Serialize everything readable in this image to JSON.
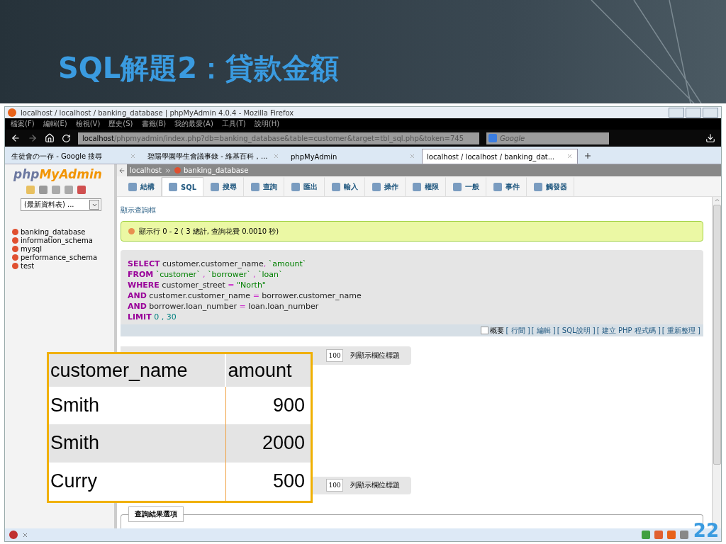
{
  "slide": {
    "title": "SQL解題2：貸款金額",
    "page_number": "22"
  },
  "browser": {
    "window_title": "localhost / localhost / banking_database | phpMyAdmin 4.0.4 - Mozilla Firefox",
    "menu": [
      "檔案(F)",
      "編輯(E)",
      "檢視(V)",
      "歷史(S)",
      "書籤(B)",
      "我的最愛(A)",
      "工具(T)",
      "說明(H)"
    ],
    "address": {
      "host": "localhost",
      "path": "/phpmyadmin/index.php?db=banking_database&table=customer&target=tbl_sql.php&token=745"
    },
    "search_placeholder": "Google",
    "tabs": [
      {
        "label": "生徒會の一存 - Google 搜尋",
        "selected": false
      },
      {
        "label": "碧陽學園學生會議事錄 - 維基百科，...",
        "selected": false
      },
      {
        "label": "phpMyAdmin",
        "selected": false
      },
      {
        "label": "localhost / localhost / banking_dat...",
        "selected": true
      }
    ]
  },
  "sidebar": {
    "logo": {
      "part_1": "php",
      "part_2": "MyAdmin"
    },
    "recent_select": "(最新資料表) ...",
    "databases": [
      "banking_database",
      "information_schema",
      "mysql",
      "performance_schema",
      "test"
    ]
  },
  "breadcrumb": [
    "localhost",
    "banking_database"
  ],
  "pma_tabs": [
    {
      "label": "結構",
      "selected": false
    },
    {
      "label": "SQL",
      "selected": true
    },
    {
      "label": "搜尋",
      "selected": false
    },
    {
      "label": "查詢",
      "selected": false
    },
    {
      "label": "匯出",
      "selected": false
    },
    {
      "label": "輸入",
      "selected": false
    },
    {
      "label": "操作",
      "selected": false
    },
    {
      "label": "權限",
      "selected": false
    },
    {
      "label": "一般",
      "selected": false
    },
    {
      "label": "事件",
      "selected": false
    },
    {
      "label": "觸發器",
      "selected": false
    }
  ],
  "show_query_link": "顯示查詢框",
  "success_message": "顯示行 0 - 2 ( 3 總計, 查詢花費 0.0010 秒)",
  "sql_lines": [
    [
      {
        "kind": "keyword",
        "text": "SELECT"
      },
      {
        "kind": "plain",
        "text": " customer.customer_name"
      },
      {
        "kind": "punct",
        "text": ", "
      },
      {
        "kind": "string",
        "text": "`amount`"
      }
    ],
    [
      {
        "kind": "keyword",
        "text": "FROM"
      },
      {
        "kind": "string",
        "text": " `customer`"
      },
      {
        "kind": "punct",
        "text": " , "
      },
      {
        "kind": "string",
        "text": "`borrower`"
      },
      {
        "kind": "punct",
        "text": " , "
      },
      {
        "kind": "string",
        "text": "`loan`"
      }
    ],
    [
      {
        "kind": "keyword",
        "text": "WHERE"
      },
      {
        "kind": "plain",
        "text": " customer_street "
      },
      {
        "kind": "punct",
        "text": "="
      },
      {
        "kind": "string",
        "text": " \"North\""
      }
    ],
    [
      {
        "kind": "keyword",
        "text": "AND"
      },
      {
        "kind": "plain",
        "text": " customer.customer_name "
      },
      {
        "kind": "punct",
        "text": "="
      },
      {
        "kind": "plain",
        "text": " borrower.customer_name"
      }
    ],
    [
      {
        "kind": "keyword",
        "text": "AND"
      },
      {
        "kind": "plain",
        "text": " borrower.loan_number "
      },
      {
        "kind": "punct",
        "text": "="
      },
      {
        "kind": "plain",
        "text": " loan.loan_number"
      }
    ],
    [
      {
        "kind": "keyword",
        "text": "LIMIT"
      },
      {
        "kind": "number",
        "text": " 0 , 30"
      }
    ]
  ],
  "sql_options": {
    "profiling": {
      "label": "概要",
      "checked": false
    },
    "links": [
      "[ 行間 ]",
      "[ 編輯 ]",
      "[ SQL說明 ]",
      "[ 建立 PHP 程式碼 ]",
      "[ 重新整理 ]"
    ]
  },
  "nav_rows": [
    {
      "rows_value": "100",
      "label": "列顯示欄位標題"
    },
    {
      "rows_value": "100",
      "label": "列顯示欄位標題"
    }
  ],
  "result_table": {
    "columns": [
      "customer_name",
      "amount"
    ],
    "rows": [
      [
        "Smith",
        "900"
      ],
      [
        "Smith",
        "2000"
      ],
      [
        "Curry",
        "500"
      ]
    ]
  },
  "options_legend": "查詢結果選項"
}
